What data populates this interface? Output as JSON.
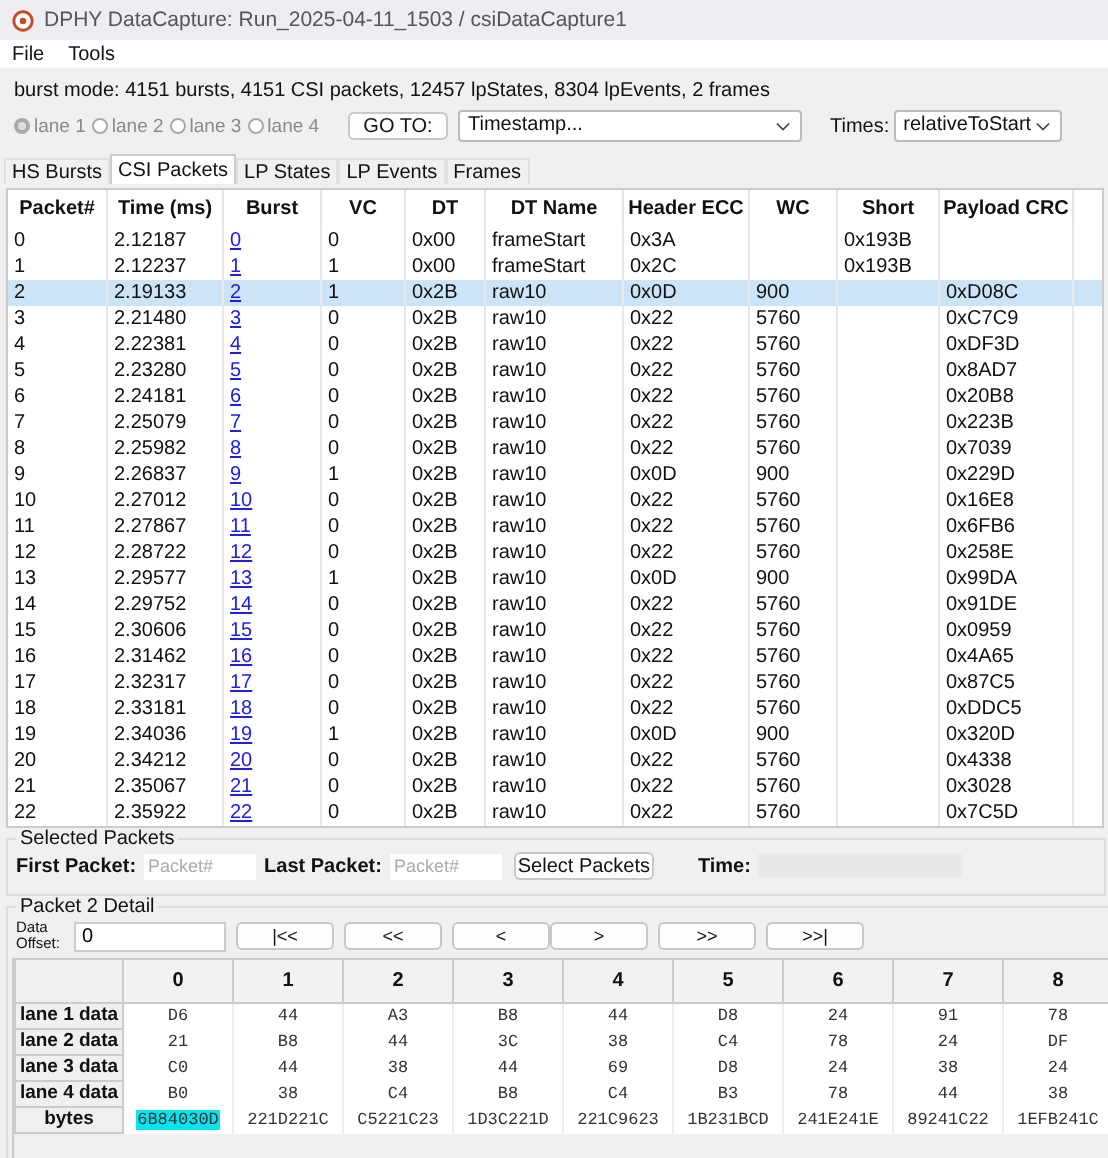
{
  "window": {
    "title": "DPHY DataCapture: Run_2025-04-11_1503 / csiDataCapture1"
  },
  "menu": [
    "File",
    "Tools"
  ],
  "summary": "burst mode: 4151 bursts, 4151 CSI packets, 12457 lpStates, 8304 lpEvents, 2 frames",
  "lanes": [
    {
      "label": "lane 1",
      "selected": true
    },
    {
      "label": "lane 2",
      "selected": false
    },
    {
      "label": "lane 3",
      "selected": false
    },
    {
      "label": "lane 4",
      "selected": false
    }
  ],
  "goto": {
    "button": "GO TO:",
    "dropdown": "Timestamp..."
  },
  "times": {
    "label": "Times:",
    "dropdown": "relativeToStart"
  },
  "tabs": [
    {
      "label": "HS Bursts",
      "selected": false
    },
    {
      "label": "CSI Packets",
      "selected": true
    },
    {
      "label": "LP States",
      "selected": false
    },
    {
      "label": "LP Events",
      "selected": false
    },
    {
      "label": "Frames",
      "selected": false
    }
  ],
  "table": {
    "columns": [
      {
        "label": "Packet#",
        "kind": "text"
      },
      {
        "label": "Time (ms)",
        "kind": "text"
      },
      {
        "label": "Burst",
        "kind": "link"
      },
      {
        "label": "VC",
        "kind": "text"
      },
      {
        "label": "DT",
        "kind": "text"
      },
      {
        "label": "DT Name",
        "kind": "text"
      },
      {
        "label": "Header ECC",
        "kind": "text"
      },
      {
        "label": "WC",
        "kind": "text"
      },
      {
        "label": "Short",
        "kind": "text"
      },
      {
        "label": "Payload CRC",
        "kind": "text"
      }
    ],
    "rows": [
      {
        "selected": false,
        "cells": [
          "0",
          "2.12187",
          "0",
          "0",
          "0x00",
          "frameStart",
          "0x3A",
          null,
          "0x193B",
          null
        ]
      },
      {
        "selected": false,
        "cells": [
          "1",
          "2.12237",
          "1",
          "1",
          "0x00",
          "frameStart",
          "0x2C",
          null,
          "0x193B",
          null
        ]
      },
      {
        "selected": true,
        "cells": [
          "2",
          "2.19133",
          "2",
          "1",
          "0x2B",
          "raw10",
          "0x0D",
          "900",
          null,
          "0xD08C"
        ]
      },
      {
        "selected": false,
        "cells": [
          "3",
          "2.21480",
          "3",
          "0",
          "0x2B",
          "raw10",
          "0x22",
          "5760",
          null,
          "0xC7C9"
        ]
      },
      {
        "selected": false,
        "cells": [
          "4",
          "2.22381",
          "4",
          "0",
          "0x2B",
          "raw10",
          "0x22",
          "5760",
          null,
          "0xDF3D"
        ]
      },
      {
        "selected": false,
        "cells": [
          "5",
          "2.23280",
          "5",
          "0",
          "0x2B",
          "raw10",
          "0x22",
          "5760",
          null,
          "0x8AD7"
        ]
      },
      {
        "selected": false,
        "cells": [
          "6",
          "2.24181",
          "6",
          "0",
          "0x2B",
          "raw10",
          "0x22",
          "5760",
          null,
          "0x20B8"
        ]
      },
      {
        "selected": false,
        "cells": [
          "7",
          "2.25079",
          "7",
          "0",
          "0x2B",
          "raw10",
          "0x22",
          "5760",
          null,
          "0x223B"
        ]
      },
      {
        "selected": false,
        "cells": [
          "8",
          "2.25982",
          "8",
          "0",
          "0x2B",
          "raw10",
          "0x22",
          "5760",
          null,
          "0x7039"
        ]
      },
      {
        "selected": false,
        "cells": [
          "9",
          "2.26837",
          "9",
          "1",
          "0x2B",
          "raw10",
          "0x0D",
          "900",
          null,
          "0x229D"
        ]
      },
      {
        "selected": false,
        "cells": [
          "10",
          "2.27012",
          "10",
          "0",
          "0x2B",
          "raw10",
          "0x22",
          "5760",
          null,
          "0x16E8"
        ]
      },
      {
        "selected": false,
        "cells": [
          "11",
          "2.27867",
          "11",
          "0",
          "0x2B",
          "raw10",
          "0x22",
          "5760",
          null,
          "0x6FB6"
        ]
      },
      {
        "selected": false,
        "cells": [
          "12",
          "2.28722",
          "12",
          "0",
          "0x2B",
          "raw10",
          "0x22",
          "5760",
          null,
          "0x258E"
        ]
      },
      {
        "selected": false,
        "cells": [
          "13",
          "2.29577",
          "13",
          "1",
          "0x2B",
          "raw10",
          "0x0D",
          "900",
          null,
          "0x99DA"
        ]
      },
      {
        "selected": false,
        "cells": [
          "14",
          "2.29752",
          "14",
          "0",
          "0x2B",
          "raw10",
          "0x22",
          "5760",
          null,
          "0x91DE"
        ]
      },
      {
        "selected": false,
        "cells": [
          "15",
          "2.30606",
          "15",
          "0",
          "0x2B",
          "raw10",
          "0x22",
          "5760",
          null,
          "0x0959"
        ]
      },
      {
        "selected": false,
        "cells": [
          "16",
          "2.31462",
          "16",
          "0",
          "0x2B",
          "raw10",
          "0x22",
          "5760",
          null,
          "0x4A65"
        ]
      },
      {
        "selected": false,
        "cells": [
          "17",
          "2.32317",
          "17",
          "0",
          "0x2B",
          "raw10",
          "0x22",
          "5760",
          null,
          "0x87C5"
        ]
      },
      {
        "selected": false,
        "cells": [
          "18",
          "2.33181",
          "18",
          "0",
          "0x2B",
          "raw10",
          "0x22",
          "5760",
          null,
          "0xDDC5"
        ]
      },
      {
        "selected": false,
        "cells": [
          "19",
          "2.34036",
          "19",
          "1",
          "0x2B",
          "raw10",
          "0x0D",
          "900",
          null,
          "0x320D"
        ]
      },
      {
        "selected": false,
        "cells": [
          "20",
          "2.34212",
          "20",
          "0",
          "0x2B",
          "raw10",
          "0x22",
          "5760",
          null,
          "0x4338"
        ]
      },
      {
        "selected": false,
        "cells": [
          "21",
          "2.35067",
          "21",
          "0",
          "0x2B",
          "raw10",
          "0x22",
          "5760",
          null,
          "0x3028"
        ]
      },
      {
        "selected": false,
        "cells": [
          "22",
          "2.35922",
          "22",
          "0",
          "0x2B",
          "raw10",
          "0x22",
          "5760",
          null,
          "0x7C5D"
        ]
      }
    ]
  },
  "selected_packets": {
    "title": "Selected Packets",
    "first_label": "First Packet:",
    "first_placeholder": "Packet#",
    "last_label": "Last Packet:",
    "last_placeholder": "Packet#",
    "button": "Select Packets",
    "time_label": "Time:"
  },
  "detail": {
    "title": "Packet 2 Detail",
    "offset_label": "Data Offset:",
    "offset_value": "0",
    "nav": [
      "|<<",
      "<<",
      "<",
      ">",
      ">>",
      ">>|"
    ],
    "columns": [
      "0",
      "1",
      "2",
      "3",
      "4",
      "5",
      "6",
      "7",
      "8"
    ],
    "rows": [
      {
        "label": "lane 1 data",
        "cells": [
          {
            "text": "D6",
            "selected": false
          },
          {
            "text": "44",
            "selected": false
          },
          {
            "text": "A3",
            "selected": false
          },
          {
            "text": "B8",
            "selected": false
          },
          {
            "text": "44",
            "selected": false
          },
          {
            "text": "D8",
            "selected": false
          },
          {
            "text": "24",
            "selected": false
          },
          {
            "text": "91",
            "selected": false
          },
          {
            "text": "78",
            "selected": false
          }
        ]
      },
      {
        "label": "lane 2 data",
        "cells": [
          {
            "text": "21",
            "selected": false
          },
          {
            "text": "B8",
            "selected": false
          },
          {
            "text": "44",
            "selected": false
          },
          {
            "text": "3C",
            "selected": false
          },
          {
            "text": "38",
            "selected": false
          },
          {
            "text": "C4",
            "selected": false
          },
          {
            "text": "78",
            "selected": false
          },
          {
            "text": "24",
            "selected": false
          },
          {
            "text": "DF",
            "selected": false
          }
        ]
      },
      {
        "label": "lane 3 data",
        "cells": [
          {
            "text": "C0",
            "selected": false
          },
          {
            "text": "44",
            "selected": false
          },
          {
            "text": "38",
            "selected": false
          },
          {
            "text": "44",
            "selected": false
          },
          {
            "text": "69",
            "selected": false
          },
          {
            "text": "D8",
            "selected": false
          },
          {
            "text": "24",
            "selected": false
          },
          {
            "text": "38",
            "selected": false
          },
          {
            "text": "24",
            "selected": false
          }
        ]
      },
      {
        "label": "lane 4 data",
        "cells": [
          {
            "text": "B0",
            "selected": false
          },
          {
            "text": "38",
            "selected": false
          },
          {
            "text": "C4",
            "selected": false
          },
          {
            "text": "B8",
            "selected": false
          },
          {
            "text": "C4",
            "selected": false
          },
          {
            "text": "B3",
            "selected": false
          },
          {
            "text": "78",
            "selected": false
          },
          {
            "text": "44",
            "selected": false
          },
          {
            "text": "38",
            "selected": false
          }
        ]
      },
      {
        "label": "bytes",
        "cells": [
          {
            "text": "6B84030D",
            "selected": true
          },
          {
            "text": "221D221C",
            "selected": false
          },
          {
            "text": "C5221C23",
            "selected": false
          },
          {
            "text": "1D3C221D",
            "selected": false
          },
          {
            "text": "221C9623",
            "selected": false
          },
          {
            "text": "1B231BCD",
            "selected": false
          },
          {
            "text": "241E241E",
            "selected": false
          },
          {
            "text": "89241C22",
            "selected": false
          },
          {
            "text": "1EFB241C",
            "selected": false
          }
        ]
      }
    ]
  }
}
